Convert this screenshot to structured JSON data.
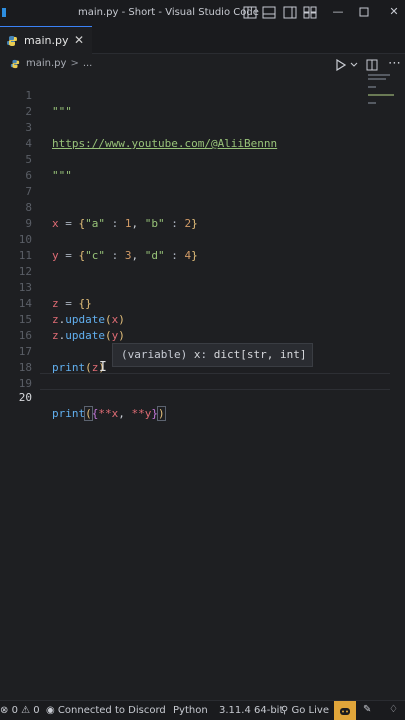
{
  "window": {
    "title": "main.py - Short - Visual Studio Code"
  },
  "tabs": [
    {
      "label": "main.py",
      "close_icon": "close-icon",
      "active": true
    }
  ],
  "breadcrumb": {
    "file": "main.py",
    "separator": ">",
    "rest": "..."
  },
  "editor": {
    "active_line": "20",
    "line_numbers": [
      "1",
      "2",
      "3",
      "4",
      "5",
      "6",
      "7",
      "8",
      "9",
      "10",
      "11",
      "12",
      "13",
      "14",
      "15",
      "16",
      "17",
      "18",
      "19",
      "20"
    ],
    "lines": {
      "l1": "\"\"\"",
      "l3": "https://www.youtube.com/@AliiBennn",
      "l5": "\"\"\"",
      "l8_var": "x",
      "l8_eq": " = ",
      "l8_open": "{",
      "l8_k1": "\"a\"",
      "l8_c1": " : ",
      "l8_v1": "1",
      "l8_sep": ", ",
      "l8_k2": "\"b\"",
      "l8_c2": " : ",
      "l8_v2": "2",
      "l8_close": "}",
      "l10_var": "y",
      "l10_eq": " = ",
      "l10_open": "{",
      "l10_k1": "\"c\"",
      "l10_c1": " : ",
      "l10_v1": "3",
      "l10_sep": ", ",
      "l10_k2": "\"d\"",
      "l10_c2": " : ",
      "l10_v2": "4",
      "l10_close": "}",
      "l13_var": "z",
      "l13_eq": " = ",
      "l13_val": "{}",
      "l14_obj": "z",
      "l14_dot": ".",
      "l14_fn": "update",
      "l14_open": "(",
      "l14_arg": "x",
      "l14_close": ")",
      "l15_obj": "z",
      "l15_dot": ".",
      "l15_fn": "update",
      "l15_open": "(",
      "l15_arg": "y",
      "l15_close": ")",
      "l17_fn": "print",
      "l17_open": "(",
      "l17_arg": "z",
      "l17_close": ")",
      "l20_fn": "print",
      "l20_open": "(",
      "l20_brace": "{",
      "l20_s1": "**x",
      "l20_sep": ", ",
      "l20_s2": "**y",
      "l20_brace_close": "}",
      "l20_close": ")"
    }
  },
  "hover": {
    "prefix": "(variable) ",
    "name": "x",
    "colon": ": ",
    "type": "dict[str, int]"
  },
  "statusbar": {
    "errors": "0",
    "warnings": "0",
    "discord": "Connected to Discord",
    "language": "Python",
    "interpreter": "3.11.4 64-bit",
    "golive": "Go Live"
  },
  "colors": {
    "accent": "#3b82f6",
    "string": "#98c379",
    "keyword_var": "#e06c75",
    "number": "#d19a66",
    "function": "#61afef",
    "copilot": "#e0a53a"
  }
}
